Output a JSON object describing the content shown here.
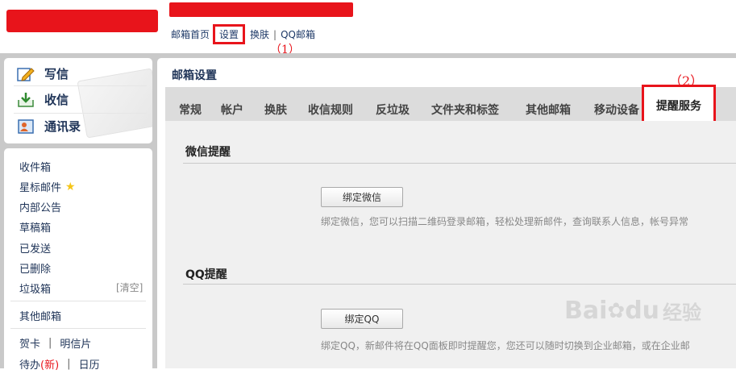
{
  "header": {
    "nav": [
      {
        "label": "邮箱首页"
      },
      {
        "label": "设置"
      },
      {
        "label": "换肤"
      },
      {
        "label": "QQ邮箱"
      }
    ],
    "nav_separator": "|"
  },
  "annotations": {
    "step1": "（1）",
    "step2": "（2）"
  },
  "sidebar": {
    "quick_actions": [
      {
        "label": "写信",
        "icon": "compose-icon"
      },
      {
        "label": "收信",
        "icon": "inbox-download-icon"
      },
      {
        "label": "通讯录",
        "icon": "contacts-icon"
      }
    ],
    "folders": [
      {
        "label": "收件箱"
      },
      {
        "label": "星标邮件",
        "icon": "star-icon"
      },
      {
        "label": "内部公告"
      },
      {
        "label": "草稿箱"
      },
      {
        "label": "已发送"
      },
      {
        "label": "已删除"
      },
      {
        "label": "垃圾箱",
        "action": "[清空]"
      }
    ],
    "other": "其他邮箱",
    "bottom_links": {
      "card": "贺卡",
      "postcard": "明信片",
      "todo": "待办",
      "todo_badge": "(新)",
      "calendar": "日历"
    }
  },
  "main": {
    "title": "邮箱设置",
    "tabs": [
      "常规",
      "帐户",
      "换肤",
      "收信规则",
      "反垃圾",
      "文件夹和标签",
      "其他邮箱",
      "移动设备",
      "提醒服务"
    ],
    "active_tab": "提醒服务",
    "sections": [
      {
        "title": "微信提醒",
        "button": "绑定微信",
        "description": "绑定微信，您可以扫描二维码登录邮箱，轻松处理新邮件，查询联系人信息，帐号异常"
      },
      {
        "title": "QQ提醒",
        "button": "绑定QQ",
        "description": "绑定QQ，新邮件将在QQ面板即时提醒您，您还可以随时切换到企业邮箱，或在企业邮"
      }
    ]
  },
  "watermark": {
    "brand": "Bai",
    "brand2": "du",
    "cn": "经验"
  },
  "colors": {
    "highlight_red": "#e8141b",
    "nav_blue": "#1f3a68"
  }
}
